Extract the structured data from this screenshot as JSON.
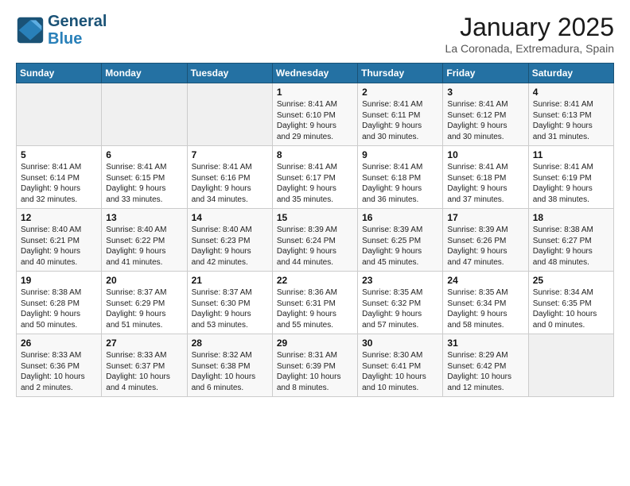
{
  "header": {
    "logo_line1": "General",
    "logo_line2": "Blue",
    "month": "January 2025",
    "location": "La Coronada, Extremadura, Spain"
  },
  "weekdays": [
    "Sunday",
    "Monday",
    "Tuesday",
    "Wednesday",
    "Thursday",
    "Friday",
    "Saturday"
  ],
  "weeks": [
    [
      {
        "day": "",
        "info": ""
      },
      {
        "day": "",
        "info": ""
      },
      {
        "day": "",
        "info": ""
      },
      {
        "day": "1",
        "info": "Sunrise: 8:41 AM\nSunset: 6:10 PM\nDaylight: 9 hours\nand 29 minutes."
      },
      {
        "day": "2",
        "info": "Sunrise: 8:41 AM\nSunset: 6:11 PM\nDaylight: 9 hours\nand 30 minutes."
      },
      {
        "day": "3",
        "info": "Sunrise: 8:41 AM\nSunset: 6:12 PM\nDaylight: 9 hours\nand 30 minutes."
      },
      {
        "day": "4",
        "info": "Sunrise: 8:41 AM\nSunset: 6:13 PM\nDaylight: 9 hours\nand 31 minutes."
      }
    ],
    [
      {
        "day": "5",
        "info": "Sunrise: 8:41 AM\nSunset: 6:14 PM\nDaylight: 9 hours\nand 32 minutes."
      },
      {
        "day": "6",
        "info": "Sunrise: 8:41 AM\nSunset: 6:15 PM\nDaylight: 9 hours\nand 33 minutes."
      },
      {
        "day": "7",
        "info": "Sunrise: 8:41 AM\nSunset: 6:16 PM\nDaylight: 9 hours\nand 34 minutes."
      },
      {
        "day": "8",
        "info": "Sunrise: 8:41 AM\nSunset: 6:17 PM\nDaylight: 9 hours\nand 35 minutes."
      },
      {
        "day": "9",
        "info": "Sunrise: 8:41 AM\nSunset: 6:18 PM\nDaylight: 9 hours\nand 36 minutes."
      },
      {
        "day": "10",
        "info": "Sunrise: 8:41 AM\nSunset: 6:18 PM\nDaylight: 9 hours\nand 37 minutes."
      },
      {
        "day": "11",
        "info": "Sunrise: 8:41 AM\nSunset: 6:19 PM\nDaylight: 9 hours\nand 38 minutes."
      }
    ],
    [
      {
        "day": "12",
        "info": "Sunrise: 8:40 AM\nSunset: 6:21 PM\nDaylight: 9 hours\nand 40 minutes."
      },
      {
        "day": "13",
        "info": "Sunrise: 8:40 AM\nSunset: 6:22 PM\nDaylight: 9 hours\nand 41 minutes."
      },
      {
        "day": "14",
        "info": "Sunrise: 8:40 AM\nSunset: 6:23 PM\nDaylight: 9 hours\nand 42 minutes."
      },
      {
        "day": "15",
        "info": "Sunrise: 8:39 AM\nSunset: 6:24 PM\nDaylight: 9 hours\nand 44 minutes."
      },
      {
        "day": "16",
        "info": "Sunrise: 8:39 AM\nSunset: 6:25 PM\nDaylight: 9 hours\nand 45 minutes."
      },
      {
        "day": "17",
        "info": "Sunrise: 8:39 AM\nSunset: 6:26 PM\nDaylight: 9 hours\nand 47 minutes."
      },
      {
        "day": "18",
        "info": "Sunrise: 8:38 AM\nSunset: 6:27 PM\nDaylight: 9 hours\nand 48 minutes."
      }
    ],
    [
      {
        "day": "19",
        "info": "Sunrise: 8:38 AM\nSunset: 6:28 PM\nDaylight: 9 hours\nand 50 minutes."
      },
      {
        "day": "20",
        "info": "Sunrise: 8:37 AM\nSunset: 6:29 PM\nDaylight: 9 hours\nand 51 minutes."
      },
      {
        "day": "21",
        "info": "Sunrise: 8:37 AM\nSunset: 6:30 PM\nDaylight: 9 hours\nand 53 minutes."
      },
      {
        "day": "22",
        "info": "Sunrise: 8:36 AM\nSunset: 6:31 PM\nDaylight: 9 hours\nand 55 minutes."
      },
      {
        "day": "23",
        "info": "Sunrise: 8:35 AM\nSunset: 6:32 PM\nDaylight: 9 hours\nand 57 minutes."
      },
      {
        "day": "24",
        "info": "Sunrise: 8:35 AM\nSunset: 6:34 PM\nDaylight: 9 hours\nand 58 minutes."
      },
      {
        "day": "25",
        "info": "Sunrise: 8:34 AM\nSunset: 6:35 PM\nDaylight: 10 hours\nand 0 minutes."
      }
    ],
    [
      {
        "day": "26",
        "info": "Sunrise: 8:33 AM\nSunset: 6:36 PM\nDaylight: 10 hours\nand 2 minutes."
      },
      {
        "day": "27",
        "info": "Sunrise: 8:33 AM\nSunset: 6:37 PM\nDaylight: 10 hours\nand 4 minutes."
      },
      {
        "day": "28",
        "info": "Sunrise: 8:32 AM\nSunset: 6:38 PM\nDaylight: 10 hours\nand 6 minutes."
      },
      {
        "day": "29",
        "info": "Sunrise: 8:31 AM\nSunset: 6:39 PM\nDaylight: 10 hours\nand 8 minutes."
      },
      {
        "day": "30",
        "info": "Sunrise: 8:30 AM\nSunset: 6:41 PM\nDaylight: 10 hours\nand 10 minutes."
      },
      {
        "day": "31",
        "info": "Sunrise: 8:29 AM\nSunset: 6:42 PM\nDaylight: 10 hours\nand 12 minutes."
      },
      {
        "day": "",
        "info": ""
      }
    ]
  ]
}
